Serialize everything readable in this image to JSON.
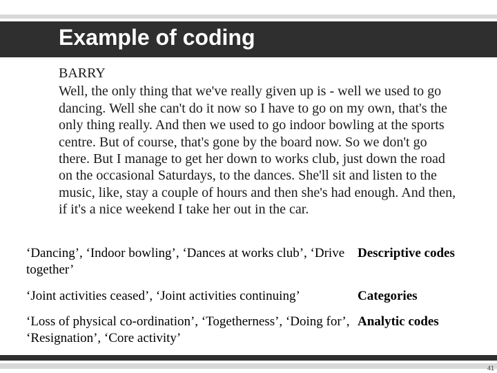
{
  "title": "Example of coding",
  "speaker": "BARRY",
  "transcript": "Well, the only thing that we've really given up is - well we used to go dancing. Well she can't do it now so I have to go on my own, that's the only thing really. And then we used to go indoor bowling at the sports centre. But of course, that's gone by the board now. So we don't go there. But I manage to get her down to works club, just down the road on the occasional Saturdays, to the dances. She'll sit and listen to the music, like, stay a couple of hours and then she's had enough.  And then, if it's a nice weekend I take her out in the car.",
  "rows": [
    {
      "left": "‘Dancing’,  ‘Indoor bowling’,  ‘Dances at works club’, ‘Drive together’",
      "right": "Descriptive codes"
    },
    {
      "left": "‘Joint activities ceased’, ‘Joint activities continuing’",
      "right": "Categories"
    },
    {
      "left": "‘Loss of physical co-ordination’, ‘Togetherness’, ‘Doing for’, ‘Resignation’, ‘Core activity’",
      "right": "Analytic codes"
    }
  ],
  "page_number": "41"
}
